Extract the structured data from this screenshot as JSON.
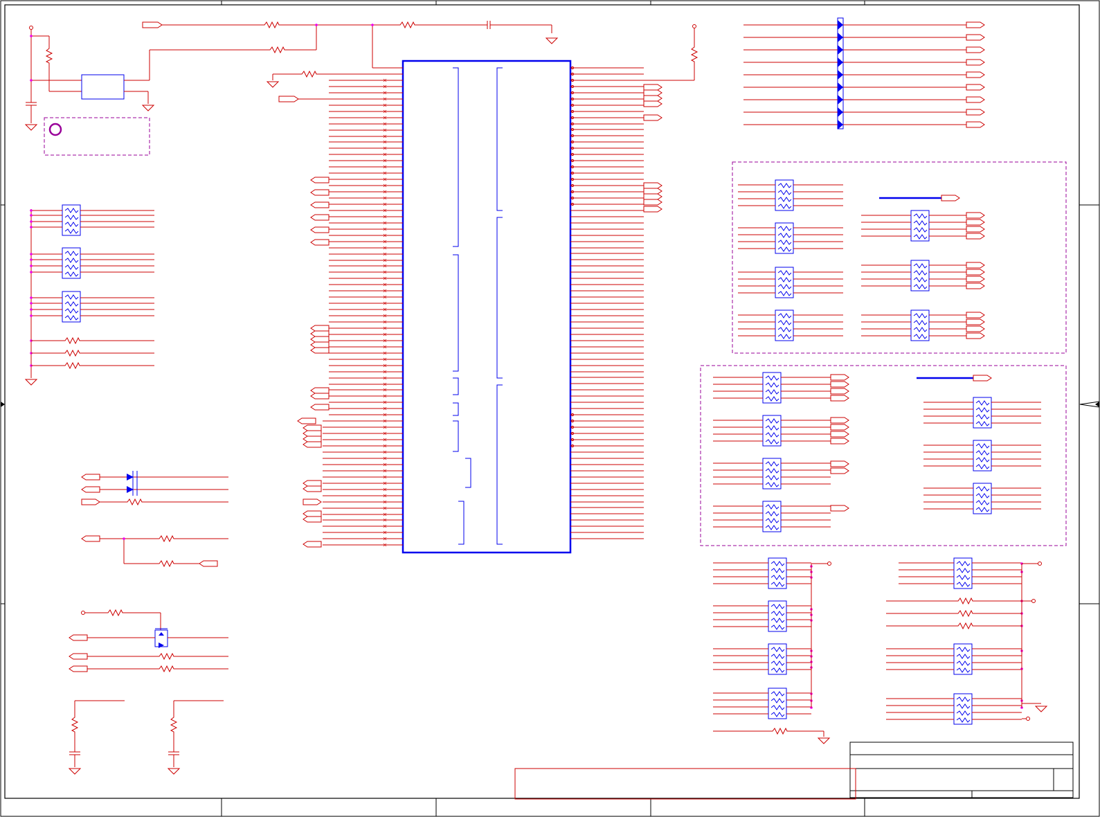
{
  "schematic": {
    "colors": {
      "wire": "#cc0000",
      "bus": "#0000ee",
      "junction": "#ee00ee",
      "group_border": "#990099",
      "frame": "#000000"
    },
    "frame": {
      "column_marks": 5,
      "row_marks": 4
    },
    "symbols": {
      "main_ic": "ic-body",
      "resistor": "resistor",
      "resistor_pack": "resistor-network",
      "capacitor": "capacitor",
      "ground": "ground-symbol",
      "port": "off-page-connector",
      "power": "power-pin",
      "diode": "diode",
      "transistor": "transistor",
      "crystal": "crystal-oscillator",
      "mount_hole": "mounting-hole"
    },
    "groups": [
      {
        "id": "dashed-group-right-top"
      },
      {
        "id": "dashed-group-right-middle"
      },
      {
        "id": "dashed-group-oscillator"
      }
    ],
    "title_block": {
      "title": "",
      "document_number": "",
      "revision": "",
      "sheet": ""
    },
    "notes_box": {
      "text": ""
    }
  }
}
